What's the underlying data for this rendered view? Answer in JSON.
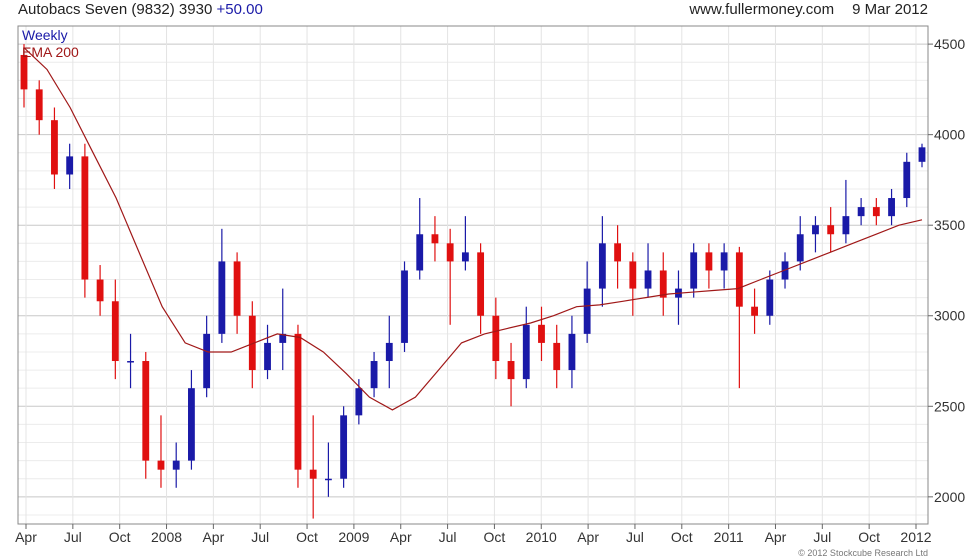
{
  "header": {
    "title": "Autobacs Seven (9832) 3930",
    "change": "+50.00",
    "site": "www.fullermoney.com",
    "date": "9 Mar 2012"
  },
  "footer": {
    "copyright": "© 2012 Stockcube Research Ltd"
  },
  "colors": {
    "up": "#1a1aa8",
    "down": "#e01010",
    "ema": "#a01818",
    "grid": "#d8d8d8",
    "legend_weekly": "#1a1aa8",
    "legend_ema": "#a01818"
  },
  "chart_data": {
    "type": "candlestick",
    "title": "Autobacs Seven (9832) 3930",
    "legend": [
      "Weekly",
      "EMA 200"
    ],
    "ylim": [
      1850,
      4600
    ],
    "y_ticks": [
      2000,
      2500,
      3000,
      3500,
      4000,
      4500
    ],
    "x_ticks": [
      "Apr",
      "Jul",
      "Oct",
      "2008",
      "Apr",
      "Jul",
      "Oct",
      "2009",
      "Apr",
      "Jul",
      "Oct",
      "2010",
      "Apr",
      "Jul",
      "Oct",
      "2011",
      "Apr",
      "Jul",
      "Oct",
      "2012"
    ],
    "grid": true,
    "series": [
      {
        "name": "Weekly",
        "points": [
          [
            "2007-04",
            4440,
            4500,
            4150,
            4250
          ],
          [
            "2007-05",
            4250,
            4300,
            4000,
            4080
          ],
          [
            "2007-06",
            4080,
            4150,
            3700,
            3780
          ],
          [
            "2007-07",
            3780,
            3950,
            3700,
            3880
          ],
          [
            "2007-08",
            3880,
            3950,
            3100,
            3200
          ],
          [
            "2007-09",
            3200,
            3280,
            3000,
            3080
          ],
          [
            "2007-10",
            3080,
            3200,
            2650,
            2750
          ],
          [
            "2007-11",
            2750,
            2900,
            2600,
            2750
          ],
          [
            "2007-12",
            2750,
            2800,
            2100,
            2200
          ],
          [
            "2008-01",
            2200,
            2450,
            2050,
            2150
          ],
          [
            "2008-02",
            2150,
            2300,
            2050,
            2200
          ],
          [
            "2008-03",
            2200,
            2700,
            2150,
            2600
          ],
          [
            "2008-04",
            2600,
            3000,
            2550,
            2900
          ],
          [
            "2008-05",
            2900,
            3480,
            2850,
            3300
          ],
          [
            "2008-06",
            3300,
            3350,
            2900,
            3000
          ],
          [
            "2008-07",
            3000,
            3080,
            2600,
            2700
          ],
          [
            "2008-08",
            2700,
            2950,
            2650,
            2850
          ],
          [
            "2008-09",
            2850,
            3150,
            2700,
            2900
          ],
          [
            "2008-10",
            2900,
            2950,
            2050,
            2150
          ],
          [
            "2008-11",
            2150,
            2450,
            1880,
            2100
          ],
          [
            "2008-12",
            2100,
            2300,
            2000,
            2100
          ],
          [
            "2009-01",
            2100,
            2500,
            2050,
            2450
          ],
          [
            "2009-02",
            2450,
            2650,
            2400,
            2600
          ],
          [
            "2009-03",
            2600,
            2800,
            2550,
            2750
          ],
          [
            "2009-04",
            2750,
            3000,
            2600,
            2850
          ],
          [
            "2009-05",
            2850,
            3300,
            2800,
            3250
          ],
          [
            "2009-06",
            3250,
            3650,
            3200,
            3450
          ],
          [
            "2009-07",
            3450,
            3550,
            3300,
            3400
          ],
          [
            "2009-08",
            3400,
            3480,
            2950,
            3300
          ],
          [
            "2009-09",
            3300,
            3550,
            3250,
            3350
          ],
          [
            "2009-10",
            3350,
            3400,
            2900,
            3000
          ],
          [
            "2009-11",
            3000,
            3100,
            2650,
            2750
          ],
          [
            "2009-12",
            2750,
            2850,
            2500,
            2650
          ],
          [
            "2010-01",
            2650,
            3050,
            2600,
            2950
          ],
          [
            "2010-02",
            2950,
            3050,
            2750,
            2850
          ],
          [
            "2010-03",
            2850,
            2950,
            2600,
            2700
          ],
          [
            "2010-04",
            2700,
            3000,
            2600,
            2900
          ],
          [
            "2010-05",
            2900,
            3300,
            2850,
            3150
          ],
          [
            "2010-06",
            3150,
            3550,
            3050,
            3400
          ],
          [
            "2010-07",
            3400,
            3500,
            3150,
            3300
          ],
          [
            "2010-08",
            3300,
            3350,
            3000,
            3150
          ],
          [
            "2010-09",
            3150,
            3400,
            3100,
            3250
          ],
          [
            "2010-10",
            3250,
            3350,
            3000,
            3100
          ],
          [
            "2010-11",
            3100,
            3250,
            2950,
            3150
          ],
          [
            "2010-12",
            3150,
            3400,
            3100,
            3350
          ],
          [
            "2011-01",
            3350,
            3400,
            3150,
            3250
          ],
          [
            "2011-02",
            3250,
            3400,
            3150,
            3350
          ],
          [
            "2011-03",
            3350,
            3380,
            2600,
            3050
          ],
          [
            "2011-04",
            3050,
            3150,
            2900,
            3000
          ],
          [
            "2011-05",
            3000,
            3250,
            2950,
            3200
          ],
          [
            "2011-06",
            3200,
            3350,
            3150,
            3300
          ],
          [
            "2011-07",
            3300,
            3550,
            3250,
            3450
          ],
          [
            "2011-08",
            3450,
            3550,
            3350,
            3500
          ],
          [
            "2011-09",
            3500,
            3600,
            3350,
            3450
          ],
          [
            "2011-10",
            3450,
            3750,
            3400,
            3550
          ],
          [
            "2011-11",
            3550,
            3650,
            3500,
            3600
          ],
          [
            "2011-12",
            3600,
            3650,
            3500,
            3550
          ],
          [
            "2012-01",
            3550,
            3700,
            3500,
            3650
          ],
          [
            "2012-02",
            3650,
            3900,
            3600,
            3850
          ],
          [
            "2012-03",
            3850,
            3950,
            3820,
            3930
          ]
        ]
      },
      {
        "name": "EMA 200",
        "values": [
          4480,
          4360,
          4150,
          3900,
          3650,
          3350,
          3050,
          2850,
          2800,
          2800,
          2850,
          2900,
          2880,
          2800,
          2680,
          2550,
          2480,
          2550,
          2700,
          2850,
          2900,
          2930,
          2960,
          3000,
          3050,
          3060,
          3080,
          3100,
          3120,
          3130,
          3140,
          3150,
          3200,
          3250,
          3300,
          3350,
          3400,
          3450,
          3500,
          3530
        ]
      }
    ]
  }
}
